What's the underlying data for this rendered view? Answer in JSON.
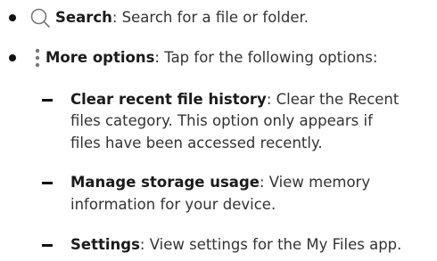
{
  "items": [
    {
      "icon": "search-icon",
      "term": "Search",
      "desc": ": Search for a file or folder."
    },
    {
      "icon": "more-options-icon",
      "term": "More options",
      "desc": ": Tap for the following options:",
      "subitems": [
        {
          "term": "Clear recent file history",
          "desc_lines": [
            ": Clear the Recent",
            "files category. This option only appears if",
            "files have been accessed recently."
          ]
        },
        {
          "term": "Manage storage usage",
          "desc_lines": [
            ": View memory",
            "information for your device."
          ]
        },
        {
          "term": "Settings",
          "desc_lines": [
            ": View settings for the My Files app."
          ]
        }
      ]
    }
  ]
}
